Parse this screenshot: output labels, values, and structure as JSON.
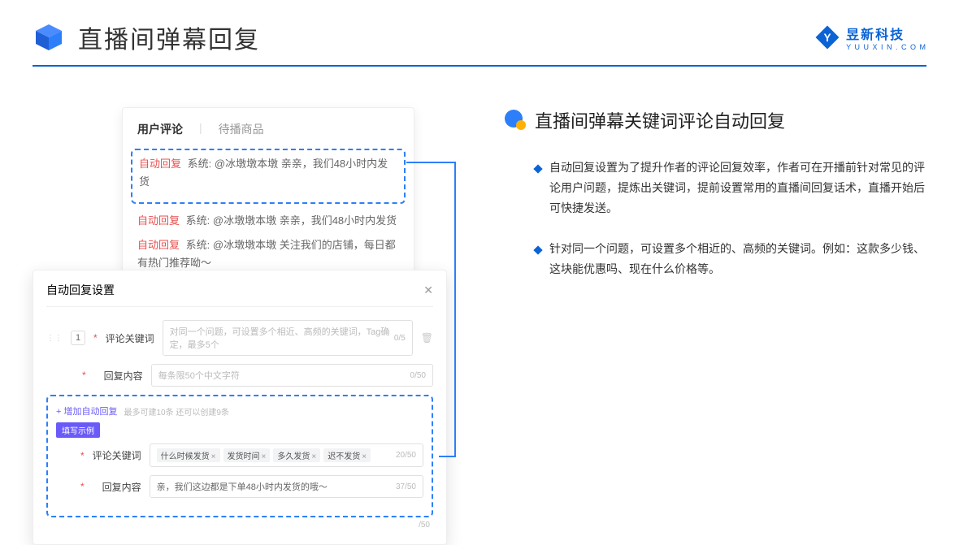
{
  "header": {
    "title": "直播间弹幕回复",
    "brand_main": "昱新科技",
    "brand_sub": "Y U U X I N . C O M"
  },
  "commentPanel": {
    "tab_active": "用户评论",
    "tab_inactive": "待播商品",
    "auto_tag": "自动回复",
    "sys_label": "系统:",
    "comments": [
      "@冰墩墩本墩 亲亲，我们48小时内发货",
      "@冰墩墩本墩 亲亲，我们48小时内发货",
      "@冰墩墩本墩 关注我们的店铺，每日都有热门推荐呦～"
    ]
  },
  "settings": {
    "header": "自动回复设置",
    "index": "1",
    "label_keyword": "评论关键词",
    "label_reply": "回复内容",
    "placeholder_keyword": "对同一个问题，可设置多个相近、高频的关键词，Tag确定，最多5个",
    "placeholder_reply": "每条限50个中文字符",
    "counter_keyword": "0/5",
    "counter_reply": "0/50",
    "add_link": "+ 增加自动回复",
    "add_hint": "最多可建10条 还可以创建9条",
    "example_tag": "填写示例",
    "example_keyword_label": "评论关键词",
    "example_reply_label": "回复内容",
    "example_tags": [
      "什么时候发货",
      "发货时间",
      "多久发货",
      "迟不发货"
    ],
    "example_kw_counter": "20/50",
    "example_reply_value": "亲，我们这边都是下单48小时内发货的哦～",
    "example_reply_counter": "37/50",
    "trailing_counter": "/50"
  },
  "right": {
    "heading": "直播间弹幕关键词评论自动回复",
    "bullets": [
      "自动回复设置为了提升作者的评论回复效率，作者可在开播前针对常见的评论用户问题，提炼出关键词，提前设置常用的直播间回复话术，直播开始后可快捷发送。",
      "针对同一个问题，可设置多个相近的、高频的关键词。例如：这款多少钱、这块能优惠吗、现在什么价格等。"
    ]
  }
}
